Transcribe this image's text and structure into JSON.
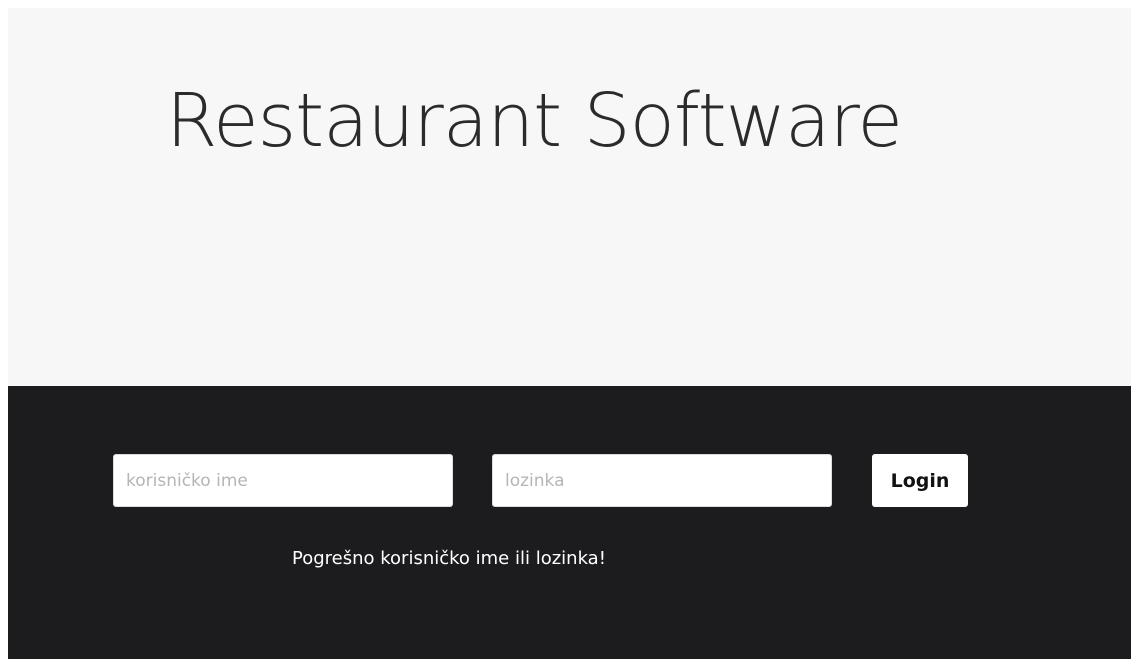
{
  "header": {
    "title": "Restaurant Software"
  },
  "login": {
    "username_placeholder": "korisničko ime",
    "username_value": "",
    "password_placeholder": "lozinka",
    "password_value": "",
    "login_label": "Login",
    "error_message": "Pogrešno korisničko ime ili lozinka!"
  },
  "colors": {
    "header_bg": "#f7f7f7",
    "panel_bg": "#1c1c1e",
    "title_text": "#2b2b2b",
    "error_text": "#ffffff"
  }
}
